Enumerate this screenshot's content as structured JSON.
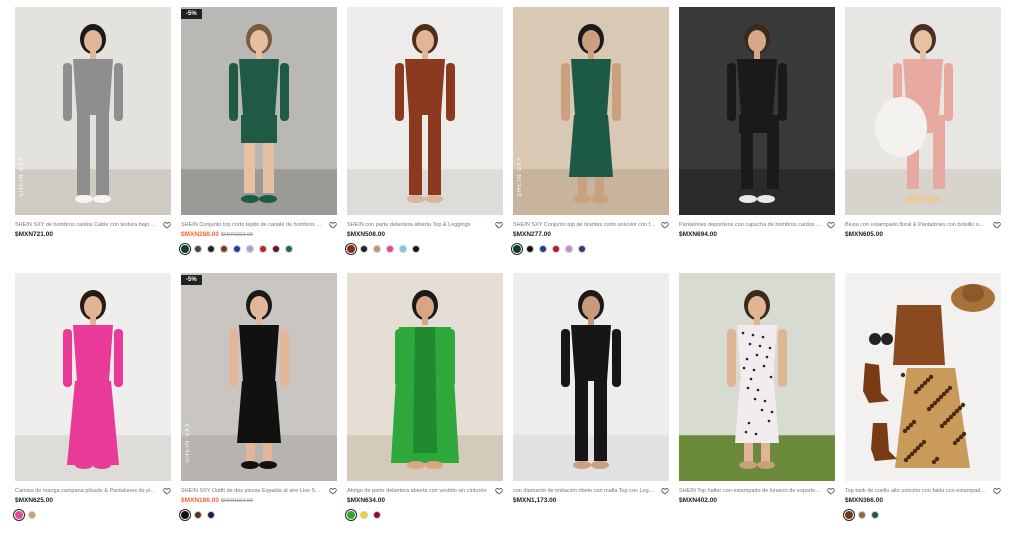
{
  "products": [
    {
      "title": "SHEIN SXY de hombros caídos Cable con textura bajo ...",
      "price": "$MXN721.00",
      "sale": false,
      "original_price": "",
      "badge": "",
      "watermark": "SHEIN SXY",
      "swatches": []
    },
    {
      "title": "SHEIN Conjunto top corto tejido de canalé de hombros ...",
      "price": "$MXN288.00",
      "sale": true,
      "original_price": "$MXN303.00",
      "badge": "-5%",
      "watermark": "",
      "swatches": [
        "#0f3d2e",
        "#4a4a3a",
        "#222222",
        "#7a3a1c",
        "#1f3fa0",
        "#b59ad4",
        "#c81e2e",
        "#6b1020",
        "#1f6b55"
      ]
    },
    {
      "title": "SHEIN con parte delantera abierta Top & Leggings",
      "price": "$MXN508.00",
      "sale": false,
      "original_price": "",
      "badge": "",
      "watermark": "",
      "swatches": [
        "#8b2a1a",
        "#222222",
        "#c4956a",
        "#e8459b",
        "#7ec6dc",
        "#111111"
      ]
    },
    {
      "title": "SHEIN SXY Conjunto top de tirantes corto unicolor con f...",
      "price": "$MXN277.00",
      "sale": false,
      "original_price": "",
      "badge": "",
      "watermark": "SHEIN SXY",
      "swatches": [
        "#0d3b2c",
        "#111111",
        "#1f3a9c",
        "#c0142a",
        "#c98bd8",
        "#3a3470"
      ]
    },
    {
      "title": "Pantalones deportivos con capucha de hombros caídos ...",
      "price": "$MXN694.00",
      "sale": false,
      "original_price": "",
      "badge": "",
      "watermark": "",
      "swatches": []
    },
    {
      "title": "Blusa con estampado floral & Pantalones con bolsillo obl...",
      "price": "$MXN605.00",
      "sale": false,
      "original_price": "",
      "badge": "",
      "watermark": "",
      "swatches": []
    },
    {
      "title": "Camisa de manga campana plisado & Pantalones de pi...",
      "price": "$MXN625.00",
      "sale": false,
      "original_price": "",
      "badge": "",
      "watermark": "",
      "swatches": [
        "#e8459b",
        "#c9a07a"
      ]
    },
    {
      "title": "SHEIN SXY Outfit de dos piezas Espalda al aire Liso Sexy",
      "price": "$MXN186.00",
      "sale": true,
      "original_price": "$MXN194.00",
      "badge": "-5%",
      "watermark": "SHEIN SXY",
      "swatches": [
        "#111111",
        "#5a2f20",
        "#2a1a3a"
      ]
    },
    {
      "title": "Abrigo de parte delantera abierta con vestido sin cinturón",
      "price": "$MXN634.00",
      "sale": false,
      "original_price": "",
      "badge": "",
      "watermark": "",
      "swatches": [
        "#2ea83a",
        "#f2d21a",
        "#8a1030"
      ]
    },
    {
      "title": "con diamante de imitación ribete con malla Top con Leg...",
      "price": "$MXN1,173.00",
      "sale": false,
      "original_price": "",
      "badge": "",
      "watermark": "",
      "swatches": []
    },
    {
      "title": "SHEIN Top halter con estampado de lunares de esparte...",
      "price": "$MXN402.00",
      "sale": false,
      "original_price": "",
      "badge": "",
      "watermark": "",
      "swatches": []
    },
    {
      "title": "Top tank de cuello alto unicolor con falda con estampado ...",
      "price": "$MXN366.00",
      "sale": false,
      "original_price": "",
      "badge": "",
      "watermark": "",
      "swatches": [
        "#6b3a1f",
        "#8a6a3a",
        "#1f5a3a"
      ]
    }
  ],
  "colors": {
    "sale_price": "#fa6338",
    "text": "#222222",
    "muted": "#777777"
  },
  "icons": {
    "favorite": "heart-outline-icon"
  }
}
